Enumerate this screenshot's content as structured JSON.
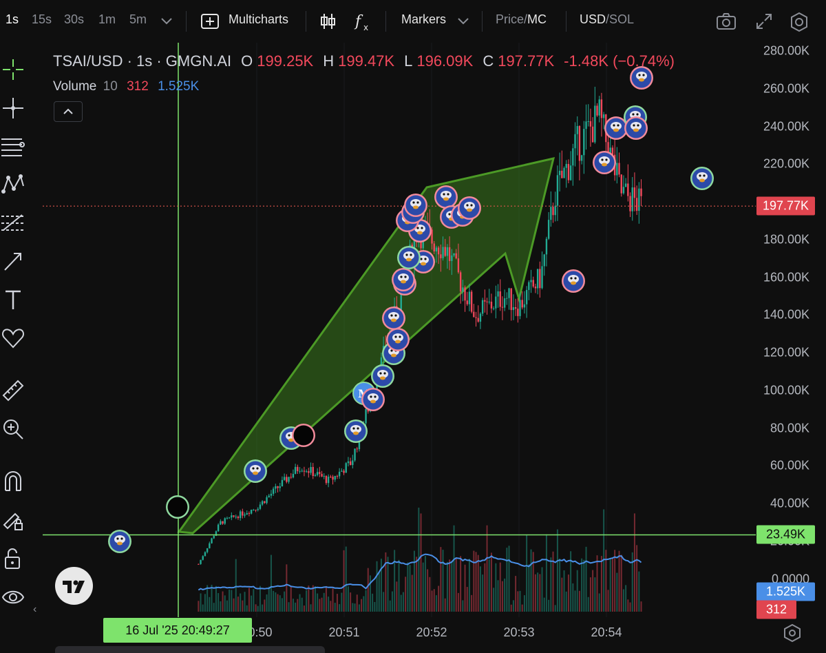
{
  "toolbar": {
    "intervals": [
      "1s",
      "15s",
      "30s",
      "1m",
      "5m"
    ],
    "active_interval": "1s",
    "multicharts_label": "Multicharts",
    "markers_label": "Markers",
    "price_label": "Price",
    "price_sep": "/",
    "mc_label": "MC",
    "usd_label": "USD",
    "currency_sep": "/",
    "sol_label": "SOL"
  },
  "legend": {
    "symbol": "TSAI/USD · 1s · GMGN.AI",
    "open_key": "O",
    "open": "199.25K",
    "high_key": "H",
    "high": "199.47K",
    "low_key": "L",
    "low": "196.09K",
    "close_key": "C",
    "close": "197.77K",
    "change": "-1.48K (−0.74%)"
  },
  "volume_legend": {
    "label": "Volume",
    "length": "10",
    "value": "312",
    "ma": "1.525K"
  },
  "price_axis": {
    "labels": [
      "280.00K",
      "260.00K",
      "240.00K",
      "220.00K",
      "200.00K",
      "180.00K",
      "160.00K",
      "140.00K",
      "120.00K",
      "100.00K",
      "80.00K",
      "60.00K",
      "40.00K",
      "20.00K",
      "0.0000"
    ]
  },
  "tags": {
    "last_price": "197.77K",
    "crosshair_price": "23.49K",
    "volume_ma": "1.525K",
    "volume_last": "312",
    "crosshair_time": "16 Jul '25   20:49:27"
  },
  "time_axis": {
    "labels": [
      "20:50",
      "20:51",
      "20:52",
      "20:53",
      "20:54"
    ]
  },
  "colors": {
    "up": "#22ab94",
    "down": "#f2495c",
    "volume_ma": "#4a8fe7",
    "crosshair": "#7ee36c",
    "arrow_fill": "#3a7a1e",
    "last_price_line": "#e0564d"
  },
  "chart_data": {
    "type": "candlestick",
    "unit": "USD (market cap)",
    "ylim": [
      0,
      290000
    ],
    "series_close": [
      {
        "time": "20:49:20",
        "value": 8000
      },
      {
        "time": "20:49:35",
        "value": 30000
      },
      {
        "time": "20:50:00",
        "value": 38000
      },
      {
        "time": "20:50:30",
        "value": 60000
      },
      {
        "time": "20:50:50",
        "value": 52000
      },
      {
        "time": "20:51:05",
        "value": 62000
      },
      {
        "time": "20:51:20",
        "value": 100000
      },
      {
        "time": "20:51:35",
        "value": 140000
      },
      {
        "time": "20:51:50",
        "value": 185000
      },
      {
        "time": "20:52:10",
        "value": 175000
      },
      {
        "time": "20:52:30",
        "value": 140000
      },
      {
        "time": "20:52:50",
        "value": 150000
      },
      {
        "time": "20:53:00",
        "value": 145000
      },
      {
        "time": "20:53:15",
        "value": 160000
      },
      {
        "time": "20:53:25",
        "value": 205000
      },
      {
        "time": "20:53:40",
        "value": 230000
      },
      {
        "time": "20:53:55",
        "value": 245000
      },
      {
        "time": "20:54:10",
        "value": 205000
      },
      {
        "time": "20:54:25",
        "value": 197770
      }
    ]
  }
}
